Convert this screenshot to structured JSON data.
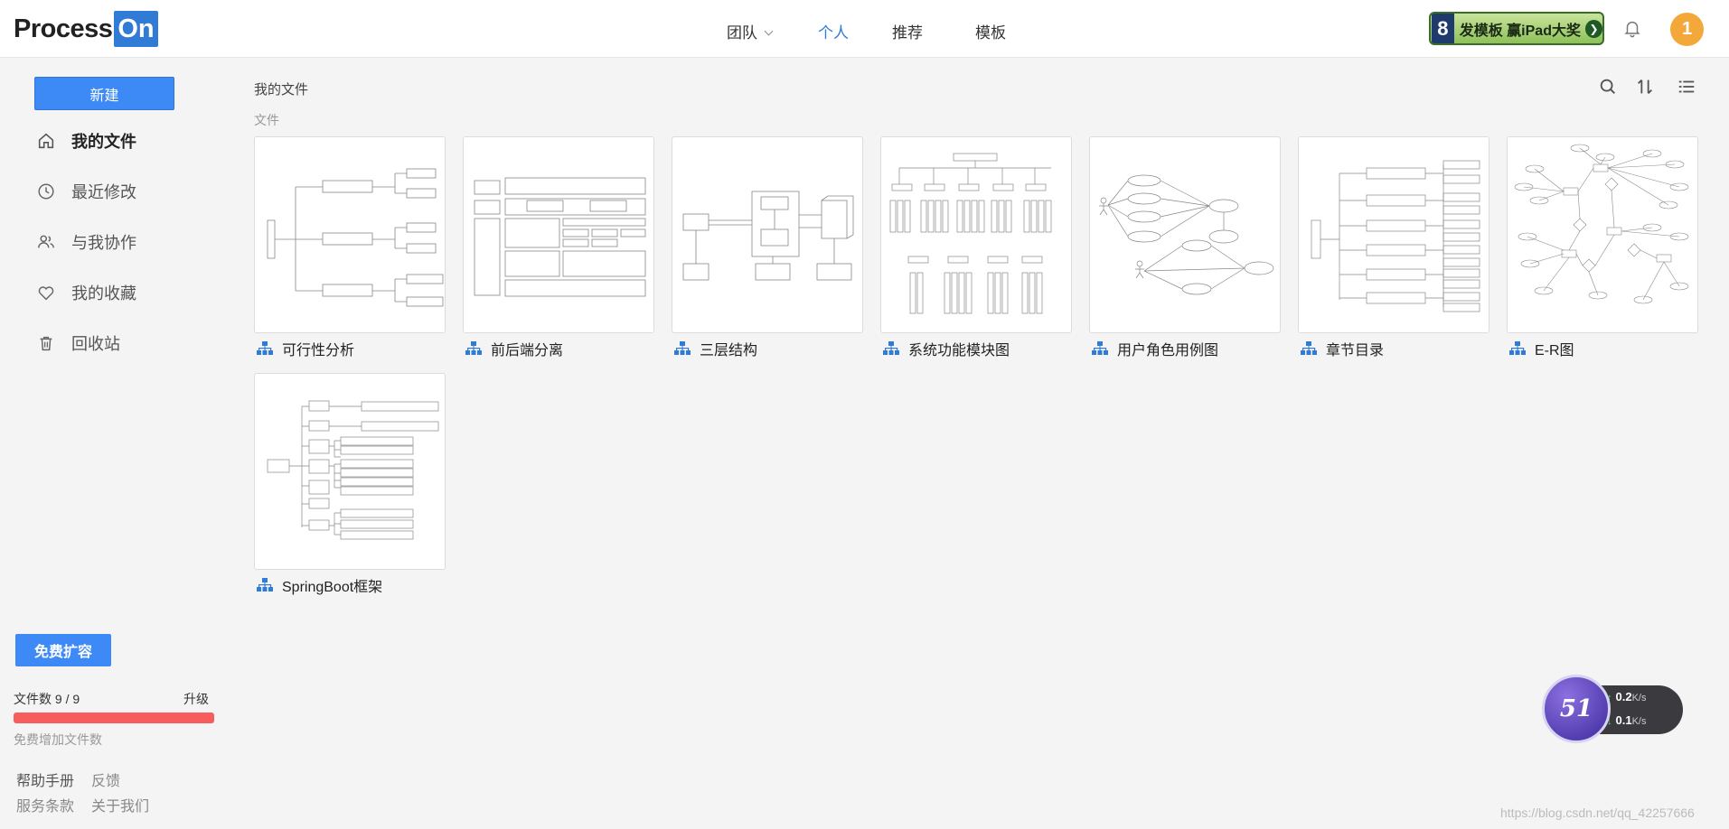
{
  "header": {
    "logo_part1": "Process",
    "logo_part2": "On",
    "nav": [
      {
        "label": "团队",
        "has_dropdown": true,
        "active": false
      },
      {
        "label": "个人",
        "active": true
      },
      {
        "label": "推荐",
        "active": false
      },
      {
        "label": "模板",
        "active": false
      }
    ],
    "promo_text": "发模板 赢iPad大奖",
    "avatar_text": "1"
  },
  "sidebar": {
    "new_button": "新建",
    "items": [
      {
        "label": "我的文件",
        "icon": "home-icon",
        "active": true
      },
      {
        "label": "最近修改",
        "icon": "clock-icon",
        "active": false
      },
      {
        "label": "与我协作",
        "icon": "users-icon",
        "active": false
      },
      {
        "label": "我的收藏",
        "icon": "heart-icon",
        "active": false
      },
      {
        "label": "回收站",
        "icon": "trash-icon",
        "active": false
      }
    ],
    "expand_button": "免费扩容",
    "file_count_label": "文件数 9 / 9",
    "file_count_used": 9,
    "file_count_total": 9,
    "upgrade_label": "升级",
    "free_increase_label": "免费增加文件数",
    "footer_links": [
      "帮助手册",
      "反馈",
      "服务条款",
      "关于我们"
    ]
  },
  "main": {
    "breadcrumb": "我的文件",
    "section_label": "文件",
    "tools": [
      "search-icon",
      "sort-icon",
      "list-view-icon"
    ],
    "files": [
      {
        "title": "可行性分析",
        "thumbnail": "mindmap"
      },
      {
        "title": "前后端分离",
        "thumbnail": "architecture"
      },
      {
        "title": "三层结构",
        "thumbnail": "three-tier"
      },
      {
        "title": "系统功能模块图",
        "thumbnail": "module-tree"
      },
      {
        "title": "用户角色用例图",
        "thumbnail": "usecase"
      },
      {
        "title": "章节目录",
        "thumbnail": "chapters"
      },
      {
        "title": "E-R图",
        "thumbnail": "er"
      },
      {
        "title": "SpringBoot框架",
        "thumbnail": "springboot"
      }
    ]
  },
  "speed_widget": {
    "badge": "51",
    "upload": "0.2",
    "download": "0.1",
    "unit": "K/s"
  },
  "watermark": "https://blog.csdn.net/qq_42257666",
  "colors": {
    "accent": "#3d8af7",
    "nav_active": "#2f7bd6",
    "progress": "#f75d5d",
    "avatar": "#f4a83a"
  }
}
